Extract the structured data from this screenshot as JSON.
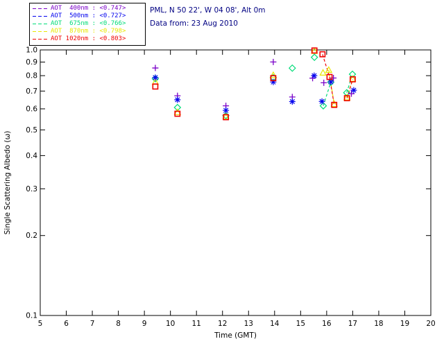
{
  "header": {
    "location_line": "PML, N 50 22', W 04 08', Alt 0m",
    "data_from_line": "Data from: 23 Aug 2010",
    "text_color": "#000082"
  },
  "legend": {
    "items": [
      {
        "label": "AOT  400nm : <0.747>",
        "wavelength": "400nm",
        "mean_value": "<0.747>",
        "color": "#7a00c8"
      },
      {
        "label": "AOT  500nm : <0.727>",
        "wavelength": "500nm",
        "mean_value": "<0.727>",
        "color": "#0000ee"
      },
      {
        "label": "AOT  675nm : <0.766>",
        "wavelength": "675nm",
        "mean_value": "<0.766>",
        "color": "#00dc78"
      },
      {
        "label": "AOT  870nm : <0.798>",
        "wavelength": "870nm",
        "mean_value": "<0.798>",
        "color": "#e8e800"
      },
      {
        "label": "AOT 1020nm : <0.803>",
        "wavelength": "1020nm",
        "mean_value": "<0.803>",
        "color": "#ee0000"
      }
    ]
  },
  "chart_data": {
    "type": "scatter",
    "xlabel": "Time (GMT)",
    "ylabel": "Single Scattering Albedo (ω)",
    "xlim": [
      5,
      20
    ],
    "ylim": [
      0.1,
      1.0
    ],
    "y_scale": "log",
    "grid": false,
    "axis_color": "#000000",
    "x_ticks": [
      5,
      6,
      7,
      8,
      9,
      10,
      11,
      12,
      13,
      14,
      15,
      16,
      17,
      18,
      19,
      20
    ],
    "y_ticks": [
      1.0,
      0.9,
      0.8,
      0.7,
      0.6,
      0.5,
      0.4,
      0.3,
      0.2,
      0.1
    ],
    "y_tick_labels": [
      "1.0",
      "0.9",
      "0.8",
      "0.7",
      "0.6",
      "0.5",
      "0.4",
      "0.3",
      "0.2",
      "0.1"
    ],
    "series": [
      {
        "name": "AOT 675nm",
        "marker": "diamond",
        "color": "#00dc78",
        "points": [
          [
            9.42,
            0.779
          ],
          [
            10.27,
            0.607
          ],
          [
            12.13,
            0.566
          ],
          [
            13.95,
            0.786
          ],
          [
            14.68,
            0.854
          ],
          [
            15.53,
            0.938
          ],
          [
            15.87,
            0.616
          ],
          [
            16.16,
            0.756
          ],
          [
            16.77,
            0.69
          ],
          [
            16.99,
            0.81
          ]
        ],
        "segments": [
          [
            [
              15.87,
              0.616
            ],
            [
              16.16,
              0.756
            ]
          ],
          [
            [
              16.77,
              0.69
            ],
            [
              16.99,
              0.81
            ]
          ]
        ]
      },
      {
        "name": "AOT 870nm",
        "marker": "triangle",
        "color": "#e8e800",
        "points": [
          [
            9.42,
            0.757
          ],
          [
            10.27,
            0.582
          ],
          [
            12.13,
            0.561
          ],
          [
            13.95,
            0.803
          ],
          [
            15.53,
            0.99
          ],
          [
            15.86,
            0.82
          ],
          [
            16.08,
            0.84
          ],
          [
            16.29,
            0.625
          ],
          [
            16.78,
            0.662
          ],
          [
            17.0,
            0.778
          ]
        ],
        "segments": [
          [
            [
              16.08,
              0.84
            ],
            [
              16.29,
              0.625
            ]
          ],
          [
            [
              16.78,
              0.662
            ],
            [
              17.0,
              0.778
            ]
          ]
        ]
      },
      {
        "name": "AOT 400nm",
        "marker": "plus",
        "color": "#7a00c8",
        "points": [
          [
            9.42,
            0.855
          ],
          [
            10.27,
            0.672
          ],
          [
            12.13,
            0.616
          ],
          [
            13.95,
            0.901
          ],
          [
            14.68,
            0.665
          ],
          [
            15.46,
            0.783
          ],
          [
            15.89,
            0.752
          ],
          [
            16.26,
            0.784
          ],
          [
            16.95,
            0.684
          ]
        ],
        "segments": []
      },
      {
        "name": "AOT 500nm",
        "marker": "asterisk",
        "color": "#0000ee",
        "points": [
          [
            9.42,
            0.787
          ],
          [
            10.27,
            0.649
          ],
          [
            12.13,
            0.592
          ],
          [
            13.95,
            0.757
          ],
          [
            14.68,
            0.639
          ],
          [
            15.52,
            0.8
          ],
          [
            15.82,
            0.64
          ],
          [
            16.16,
            0.758
          ],
          [
            17.04,
            0.705
          ]
        ],
        "segments": []
      },
      {
        "name": "AOT 1020nm",
        "marker": "square",
        "color": "#ee0000",
        "points": [
          [
            9.42,
            0.728
          ],
          [
            10.27,
            0.575
          ],
          [
            12.13,
            0.558
          ],
          [
            13.95,
            0.783
          ],
          [
            15.53,
            0.995
          ],
          [
            15.84,
            0.963
          ],
          [
            16.11,
            0.791
          ],
          [
            16.29,
            0.621
          ],
          [
            16.78,
            0.658
          ],
          [
            17.0,
            0.775
          ]
        ],
        "segments": [
          [
            [
              15.84,
              0.963
            ],
            [
              16.11,
              0.791
            ]
          ],
          [
            [
              16.11,
              0.791
            ],
            [
              16.29,
              0.621
            ]
          ],
          [
            [
              16.78,
              0.658
            ],
            [
              17.0,
              0.775
            ]
          ]
        ]
      }
    ]
  }
}
